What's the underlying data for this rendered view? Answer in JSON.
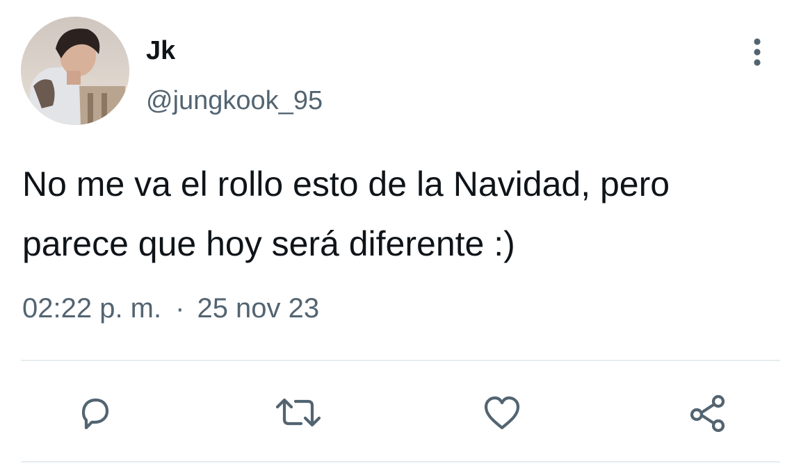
{
  "tweet": {
    "author": {
      "display_name": "Jk",
      "handle": "@jungkook_95"
    },
    "text": "No me va el rollo esto de la Navidad, pero parece que hoy será diferente :)",
    "time": "02:22 p. m.",
    "separator": "·",
    "date": "25 nov 23"
  },
  "icons": {
    "more": "more-vertical-icon",
    "reply": "reply-icon",
    "retweet": "retweet-icon",
    "like": "heart-icon",
    "share": "share-icon"
  },
  "colors": {
    "text_primary": "#0f1419",
    "text_secondary": "#536471",
    "divider": "#e6ecf0"
  }
}
